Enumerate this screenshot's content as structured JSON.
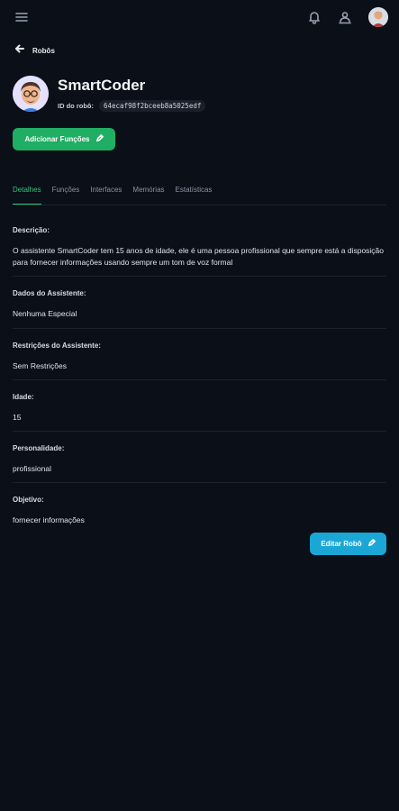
{
  "header": {
    "icons": [
      "menu-icon",
      "bell-icon",
      "user-icon",
      "avatar"
    ]
  },
  "nav": {
    "back_label": "Robôs"
  },
  "profile": {
    "name": "SmartCoder",
    "id_label": "ID do robô:",
    "id_value": "64ecaf98f2bceeb8a5025edf"
  },
  "actions": {
    "add_functions_label": "Adicionar Funções",
    "edit_robot_label": "Editar Robô"
  },
  "tabs": [
    {
      "label": "Detalhes",
      "active": true
    },
    {
      "label": "Funções",
      "active": false
    },
    {
      "label": "Interfaces",
      "active": false
    },
    {
      "label": "Memórias",
      "active": false
    },
    {
      "label": "Estatísticas",
      "active": false
    }
  ],
  "details": {
    "description_label": "Descrição:",
    "description_value": "O assistente SmartCoder tem 15 anos de idade, ele é uma pessoa profissional que sempre está a disposição para fornecer informações usando sempre um tom de voz formal",
    "assistant_data_label": "Dados do Assistente:",
    "assistant_data_value": "Nenhuma Especial",
    "restrictions_label": "Restrições do Assistente:",
    "restrictions_value": "Sem Restrições",
    "age_label": "Idade:",
    "age_value": "15",
    "personality_label": "Personalidade:",
    "personality_value": "profissional",
    "objective_label": "Objetivo:",
    "objective_value": "fornecer informações"
  },
  "colors": {
    "background": "#0b0f17",
    "accent_green": "#1fae63",
    "accent_blue": "#1aa7d6",
    "active_tab": "#31c57a"
  }
}
